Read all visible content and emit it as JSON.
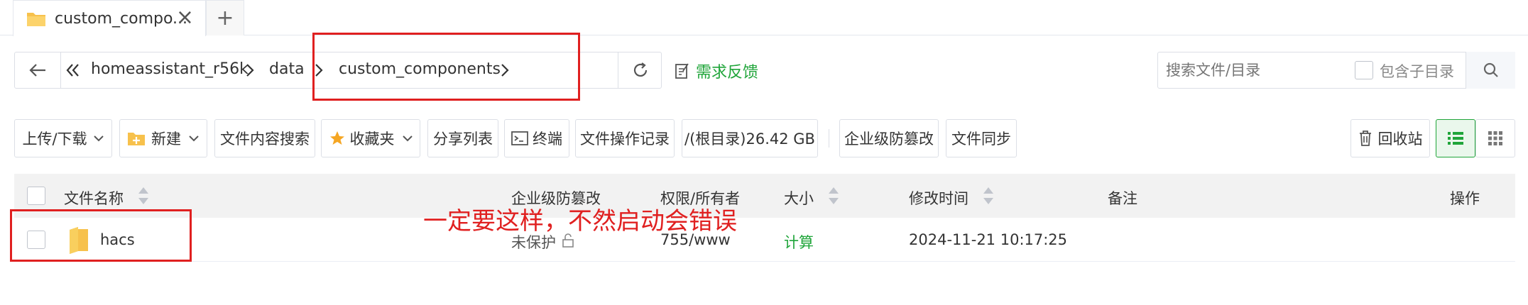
{
  "tab": {
    "title": "custom_compo...",
    "close": "×",
    "new_tab": "+"
  },
  "address": {
    "breadcrumb": [
      "homeassistant_r56k",
      "data",
      "custom_components"
    ],
    "feedback": "需求反馈"
  },
  "search": {
    "placeholder": "搜索文件/目录",
    "include_sub": "包含子目录"
  },
  "toolbar": {
    "upload": "上传/下载",
    "new": "新建",
    "content_search": "文件内容搜索",
    "favorites": "收藏夹",
    "share_list": "分享列表",
    "terminal": "终端",
    "op_log": "文件操作记录",
    "disk": "/(根目录)26.42 GB",
    "tamper": "企业级防篡改",
    "sync": "文件同步",
    "recycle": "回收站"
  },
  "table": {
    "headers": {
      "name": "文件名称",
      "tamper": "企业级防篡改",
      "perm": "权限/所有者",
      "size": "大小",
      "mtime": "修改时间",
      "note": "备注",
      "ops": "操作"
    },
    "rows": [
      {
        "name": "hacs",
        "tamper": "未保护",
        "perm": "755/www",
        "size": "计算",
        "mtime": "2024-11-21 10:17:25"
      }
    ]
  },
  "annotation": {
    "text": "一定要这样，不然启动会错误"
  },
  "colors": {
    "accent": "#20a53a",
    "annotation": "#e02020",
    "folder": "#f7c14c"
  }
}
